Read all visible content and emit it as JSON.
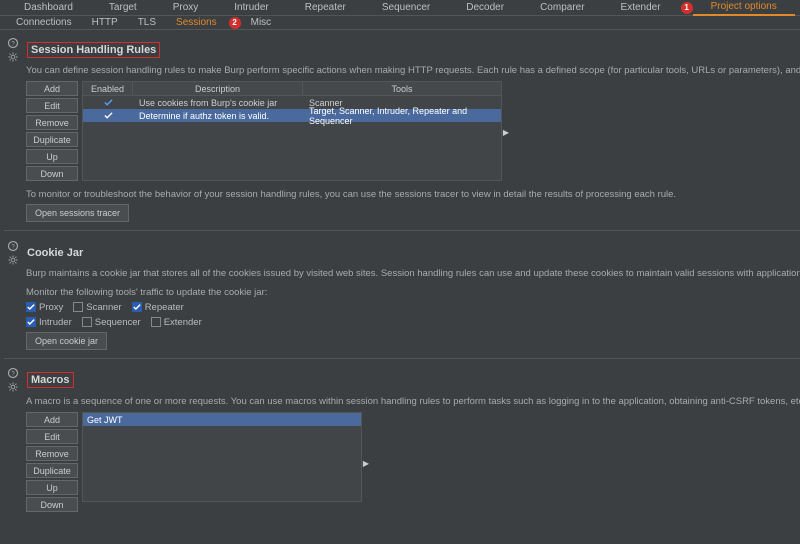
{
  "main_tabs": [
    "Dashboard",
    "Target",
    "Proxy",
    "Intruder",
    "Repeater",
    "Sequencer",
    "Decoder",
    "Comparer",
    "Extender",
    "Project options"
  ],
  "main_selected_index": 9,
  "badge1": "1",
  "sub_tabs": [
    "Connections",
    "HTTP",
    "TLS",
    "Sessions",
    "Misc"
  ],
  "sub_selected_index": 3,
  "badge2": "2",
  "session_rules": {
    "title": "Session Handling Rules",
    "desc": "You can define session handling rules to make Burp perform specific actions when making HTTP requests. Each rule has a defined scope (for particular tools, URLs or parameters), and can perform actions such as adding ses checking session validity. Before each request is issued, Burp applies in sequence each of the rules that are in-scope for the request.",
    "buttons": [
      "Add",
      "Edit",
      "Remove",
      "Duplicate",
      "Up",
      "Down"
    ],
    "headers": {
      "enabled": "Enabled",
      "description": "Description",
      "tools": "Tools"
    },
    "rows": [
      {
        "enabled": true,
        "description": "Use cookies from Burp's cookie jar",
        "tools": "Scanner",
        "selected": false
      },
      {
        "enabled": true,
        "description": "Determine if authz token is valid.",
        "tools": "Target, Scanner, Intruder, Repeater and Sequencer",
        "selected": true
      }
    ],
    "note": "To monitor or troubleshoot the behavior of your session handling rules, you can use the sessions tracer to view in detail the results of processing each rule.",
    "tracer_btn": "Open sessions tracer"
  },
  "cookie_jar": {
    "title": "Cookie Jar",
    "desc": "Burp maintains a cookie jar that stores all of the cookies issued by visited web sites. Session handling rules can use and update these cookies to maintain valid sessions with applications that are being tested. You can use the updates the cookie jar based on traffic from particular tools.",
    "monitor_label": "Monitor the following tools' traffic to update the cookie jar:",
    "checkboxes": [
      {
        "label": "Proxy",
        "checked": true
      },
      {
        "label": "Scanner",
        "checked": false
      },
      {
        "label": "Repeater",
        "checked": true
      },
      {
        "label": "Intruder",
        "checked": true
      },
      {
        "label": "Sequencer",
        "checked": false
      },
      {
        "label": "Extender",
        "checked": false
      }
    ],
    "open_btn": "Open cookie jar"
  },
  "macros": {
    "title": "Macros",
    "desc": "A macro is a sequence of one or more requests. You can use macros within session handling rules to perform tasks such as logging in to the application, obtaining anti-CSRF tokens, etc.",
    "buttons": [
      "Add",
      "Edit",
      "Remove",
      "Duplicate",
      "Up",
      "Down"
    ],
    "rows": [
      {
        "name": "Get JWT"
      }
    ]
  }
}
